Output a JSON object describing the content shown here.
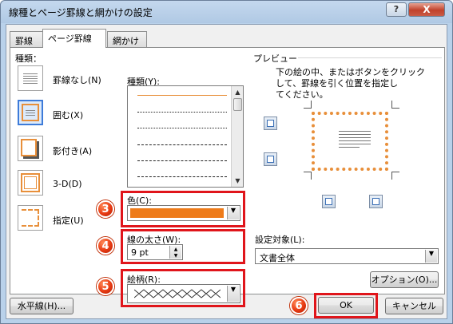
{
  "window": {
    "title": "線種とページ罫線と網かけの設定",
    "help": "?",
    "close": "X"
  },
  "tabs": [
    "罫線",
    "ページ罫線",
    "網かけ"
  ],
  "settings": {
    "label": "種類：",
    "items": [
      "罫線なし(N)",
      "囲む(X)",
      "影付き(A)",
      "3-D(D)",
      "指定(U)"
    ],
    "selected": "囲む(X)"
  },
  "style": {
    "label": "種類(Y):"
  },
  "color": {
    "label": "色(C):",
    "value_color": "#ee7b1a"
  },
  "width": {
    "label": "線の太さ(W):",
    "value": "9 pt"
  },
  "art": {
    "label": "絵柄(R):"
  },
  "preview": {
    "label": "プレビュー",
    "instruction": [
      "下の絵の中、またはボタンをクリック",
      "して、罫線を引く位置を指定し",
      "てください。"
    ]
  },
  "apply_to": {
    "label": "設定対象(L):",
    "value": "文書全体"
  },
  "buttons": {
    "options": "オプション(O)...",
    "horizontal_line": "水平線(H)...",
    "ok": "OK",
    "cancel": "キャンセル"
  },
  "badges": [
    "3",
    "4",
    "5",
    "6"
  ],
  "colors": {
    "highlight": "#e0151b",
    "badge": "#e83a12",
    "page_border": "#e88f3a"
  }
}
